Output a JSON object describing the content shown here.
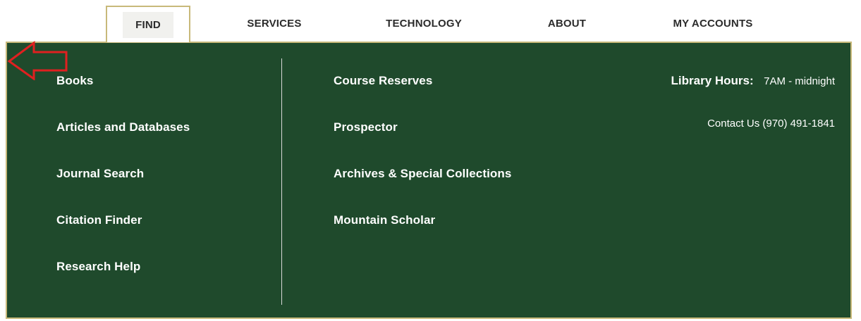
{
  "nav": {
    "items": [
      {
        "label": "FIND"
      },
      {
        "label": "SERVICES"
      },
      {
        "label": "TECHNOLOGY"
      },
      {
        "label": "ABOUT"
      },
      {
        "label": "MY ACCOUNTS"
      }
    ]
  },
  "menu": {
    "left_links": [
      "Books",
      "Articles and Databases",
      "Journal Search",
      "Citation Finder",
      "Research Help"
    ],
    "right_links": [
      "Course Reserves",
      "Prospector",
      "Archives & Special Collections",
      "Mountain Scholar"
    ],
    "hours_label": "Library Hours:",
    "hours_value": "7AM - midnight",
    "contact": "Contact Us (970) 491-1841"
  },
  "annotation": {
    "icon": "left-arrow-icon",
    "color": "#e02020"
  },
  "colors": {
    "panel_bg": "#1f4a2c",
    "border_gold": "#c8b97a"
  }
}
